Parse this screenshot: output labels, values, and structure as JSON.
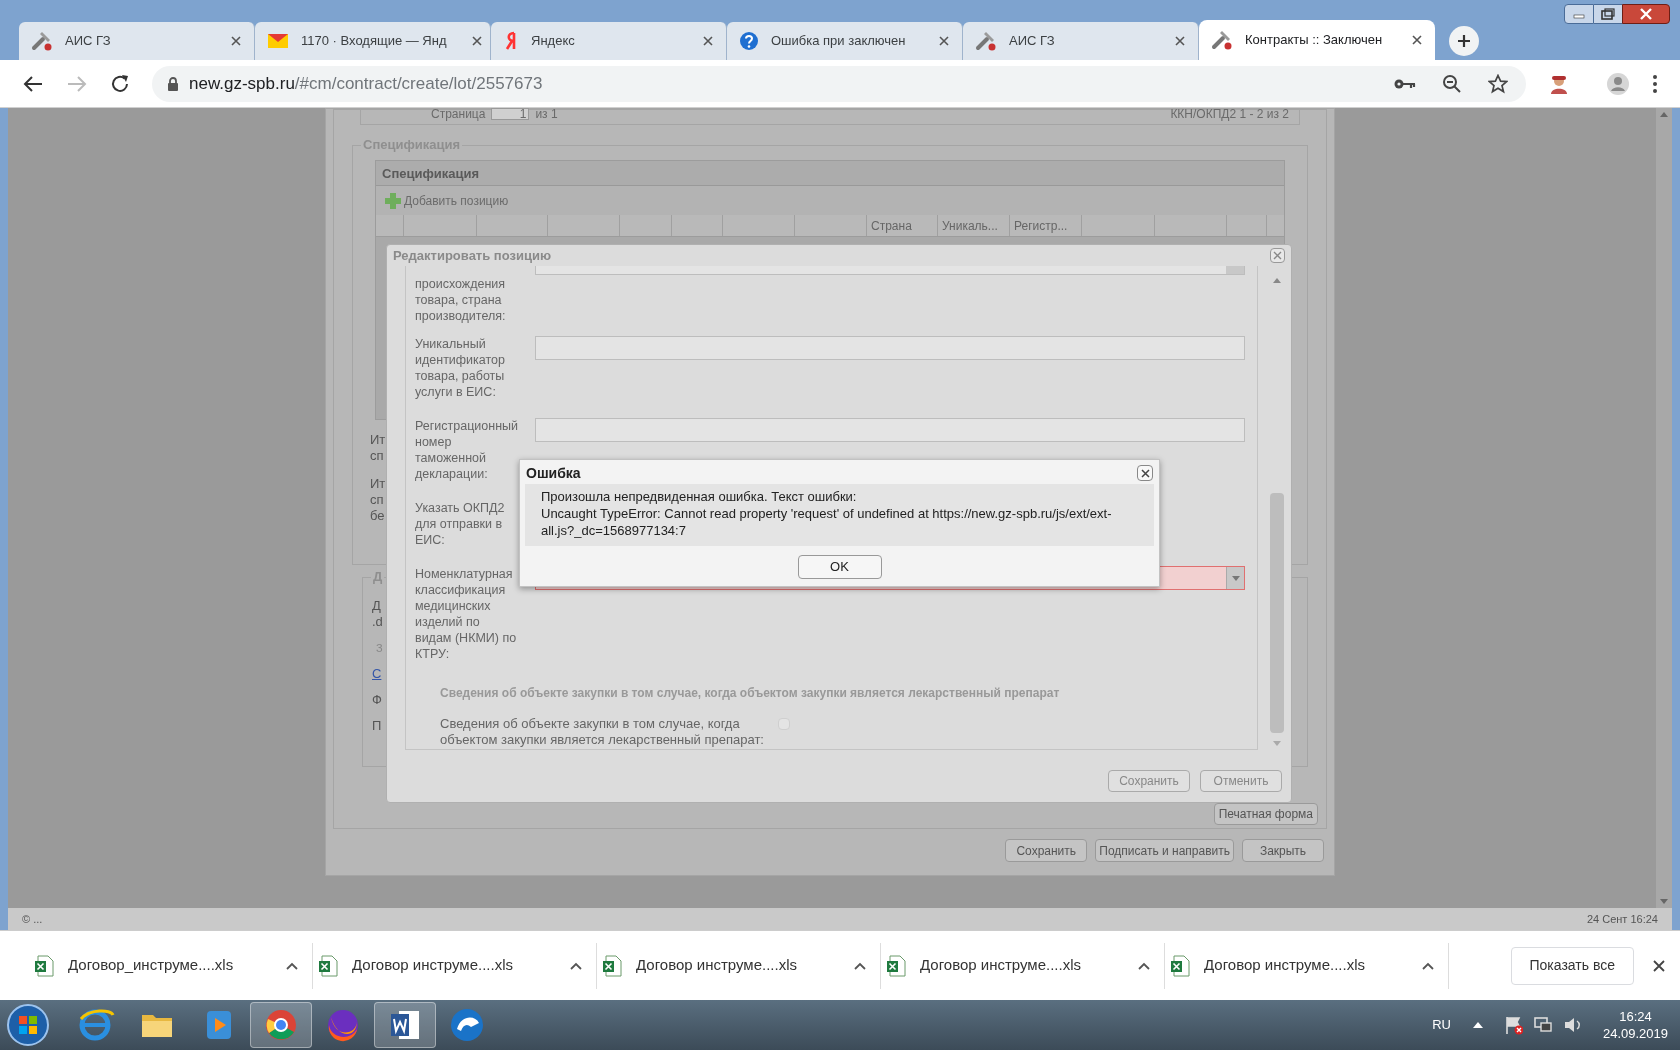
{
  "browser": {
    "tabs": [
      {
        "title": "АИС ГЗ",
        "kind": "tools",
        "selected": false
      },
      {
        "title": "1170 · Входящие — Янд",
        "kind": "mail",
        "selected": false
      },
      {
        "title": "Яндекс",
        "kind": "yandex",
        "selected": false
      },
      {
        "title": "Ошибка при заключен",
        "kind": "help",
        "selected": false
      },
      {
        "title": "АИС ГЗ",
        "kind": "tools",
        "selected": false
      },
      {
        "title": "Контракты :: Заключен",
        "kind": "tools",
        "selected": true
      }
    ],
    "url_host": "new.gz-spb.ru",
    "url_path": "/#cm/contract/create/lot/2557673"
  },
  "page": {
    "pager": {
      "label": "Страница",
      "page": "1",
      "of": "из 1",
      "summary": "ККН/ОКПД2 1 - 2 из 2"
    },
    "spec_legend": "Спецификация",
    "grid_title": "Спецификация",
    "add_button": "Добавить позицию",
    "columns": [
      "Страна",
      "Уникаль...",
      "Регистр..."
    ],
    "totals": [
      {
        "lines": [
          "Ит",
          "сп"
        ]
      },
      {
        "lines": [
          "Ит",
          "сп",
          "бе"
        ]
      }
    ],
    "docs_legend": "Д",
    "docs": [
      {
        "kind": "text",
        "lines": [
          "Д",
          ".d"
        ]
      },
      {
        "kind": "hint",
        "lines": [
          "З"
        ]
      },
      {
        "kind": "link",
        "lines": [
          "С"
        ]
      },
      {
        "kind": "text",
        "lines": [
          "Ф"
        ]
      },
      {
        "kind": "text",
        "lines": [
          "П"
        ]
      }
    ],
    "print_button": "Печатная форма",
    "buttons": [
      "Сохранить",
      "Подписать и направить",
      "Закрыть"
    ],
    "footer_left": "© ...",
    "footer_right": "24 Сент 16:24"
  },
  "edit_dialog": {
    "title": "Редактировать позицию",
    "rows": [
      {
        "label": "происхождения товара, страна производителя:",
        "kind": "cut"
      },
      {
        "label": "Уникальный идентификатор товара, работы услуги в ЕИС:",
        "kind": "text"
      },
      {
        "label": "Регистрационный номер таможенной декларации:",
        "kind": "text"
      },
      {
        "label": "Указать ОКПД2 для отправки в ЕИС:",
        "kind": "label"
      },
      {
        "label": "Номенклатурная классификация медицинских изделий по видам (НКМИ) по КТРУ:",
        "kind": "combo",
        "invalid": true
      }
    ],
    "section_title": "Сведения об объекте закупки в том случае, когда объектом закупки является лекарственный препарат",
    "checkbox": {
      "label": "Сведения об объекте закупки в том случае, когда объектом закупки является лекарственный препарат:",
      "checked": false
    },
    "buttons": [
      "Сохранить",
      "Отменить"
    ]
  },
  "error_dialog": {
    "title": "Ошибка",
    "lines": [
      "Произошла непредвиденная ошибка. Текст ошибки:",
      "Uncaught TypeError: Cannot read property 'request' of undefined at https://new.gz-spb.ru/js/ext/ext-all.js?_dc=1568977134:7"
    ],
    "button": "OK"
  },
  "downloads": {
    "items": [
      "Договор_инструме....xls",
      "Договор инструме....xls",
      "Договор инструме....xls",
      "Договор инструме....xls",
      "Договор инструме....xls"
    ],
    "show_all": "Показать все"
  },
  "taskbar": {
    "language": "RU",
    "time": "16:24",
    "date": "24.09.2019"
  }
}
